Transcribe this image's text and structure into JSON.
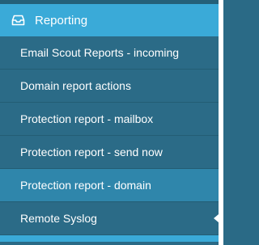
{
  "section": {
    "icon": "inbox-icon",
    "title": "Reporting",
    "accent_color": "#3aaad8"
  },
  "menu": {
    "items": [
      {
        "label": "Email Scout Reports - incoming"
      },
      {
        "label": "Domain report actions"
      },
      {
        "label": "Protection report - mailbox"
      },
      {
        "label": "Protection report - send now"
      },
      {
        "label": "Protection report - domain",
        "state": "highlighted"
      },
      {
        "label": "Remote Syslog",
        "state": "current"
      }
    ]
  }
}
